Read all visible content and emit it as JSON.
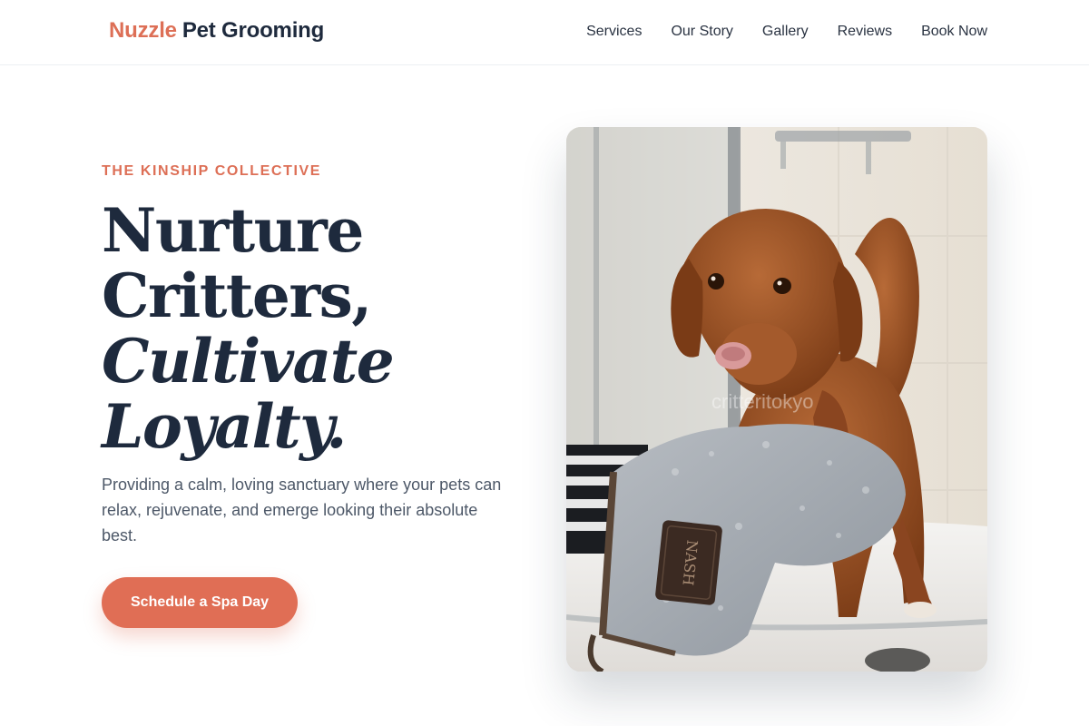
{
  "nav": {
    "logo_accent": "Nuzzle",
    "logo_rest": "Pet Grooming",
    "links": [
      "Services",
      "Our Story",
      "Gallery",
      "Reviews",
      "Book Now"
    ]
  },
  "hero": {
    "eyebrow": "THE KINSHIP COLLECTIVE",
    "headline": {
      "line1": "Nurture",
      "line2": "Critters,",
      "line3": "Cultivate",
      "line4": "Loyalty."
    },
    "subtext": "Providing a calm, loving sanctuary where your pets can relax, rejuvenate, and emerge looking their absolute best.",
    "cta_label": "Schedule a Spa Day"
  },
  "image": {
    "watermark": "critteritokyo",
    "mitt_label": "NASH"
  },
  "colors": {
    "accent": "#dd6f56",
    "text_dark": "#1e2a3d",
    "text_muted": "#4d5868"
  }
}
